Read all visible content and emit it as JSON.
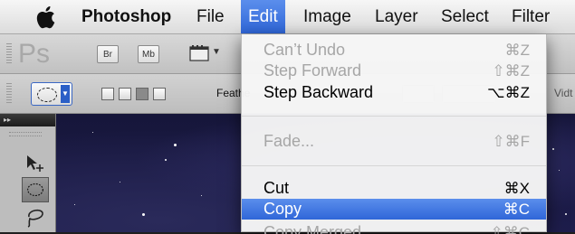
{
  "menubar": {
    "app": "Photoshop",
    "items": [
      "File",
      "Edit",
      "Image",
      "Layer",
      "Select",
      "Filter"
    ],
    "active": "Edit"
  },
  "appbar": {
    "logo": "Ps",
    "bridge_label": "Br",
    "minibridge_label": "Mb",
    "screen_mode_arrow": "▼"
  },
  "optbar": {
    "feather_label": "Feathe",
    "width_label": "Vidt"
  },
  "tools": {
    "header": "▸▸",
    "items": [
      "move-tool",
      "elliptical-marquee-tool",
      "lasso-tool"
    ]
  },
  "edit_menu": {
    "items": [
      {
        "label": "Can’t Undo",
        "shortcut": "⌘Z",
        "disabled": true
      },
      {
        "label": "Step Forward",
        "shortcut": "⇧⌘Z",
        "disabled": true
      },
      {
        "label": "Step Backward",
        "shortcut": "⌥⌘Z",
        "disabled": false
      },
      {
        "label": "Fade...",
        "shortcut": "⇧⌘F",
        "disabled": true
      },
      {
        "label": "Cut",
        "shortcut": "⌘X",
        "disabled": false
      },
      {
        "label": "Copy",
        "shortcut": "⌘C",
        "disabled": false,
        "highlighted": true
      },
      {
        "label": "Copy Merged",
        "shortcut": "⇧⌘C",
        "disabled": true
      }
    ]
  },
  "colors": {
    "highlight": "#2f66d8",
    "menu_bg": "#f6f6f6",
    "canvas": "#1e1d4c"
  }
}
